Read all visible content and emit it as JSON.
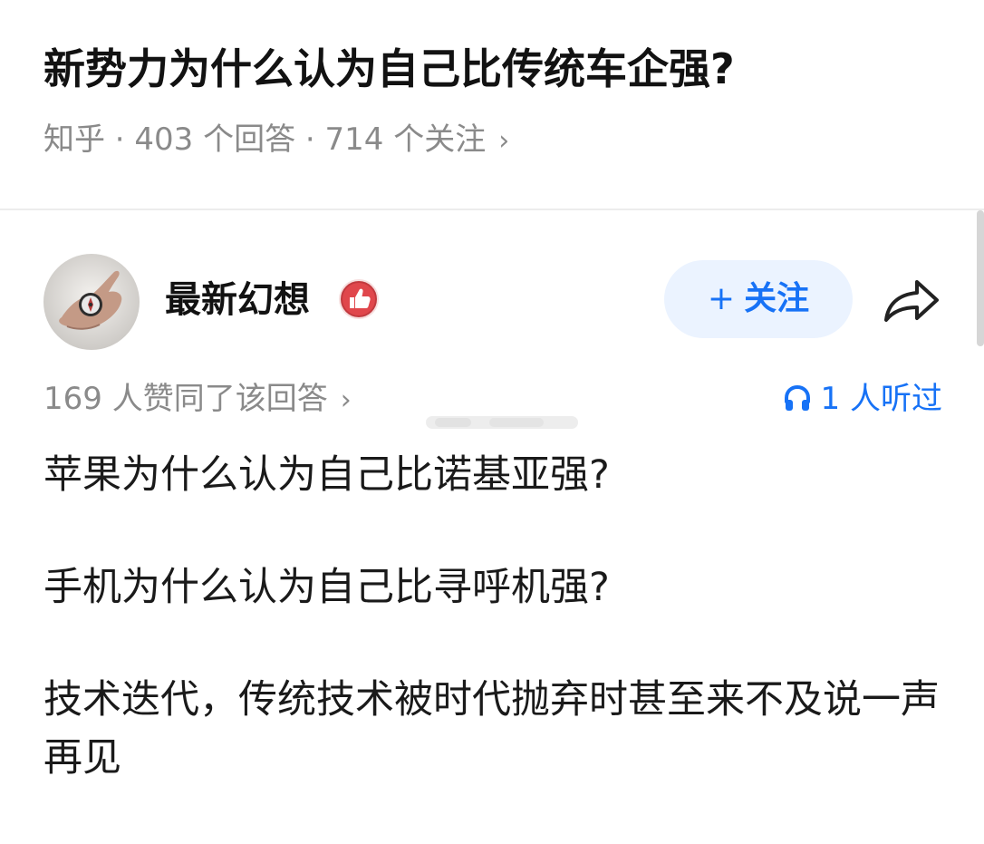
{
  "question": {
    "title": "新势力为什么认为自己比传统车企强?",
    "meta": "知乎 · 403 个回答 · 714 个关注",
    "meta_chevron": "›"
  },
  "author": {
    "name": "最新幻想",
    "avatar_icon": "compass-in-hand-photo",
    "badge_icon": "thumbs-up-badge-icon",
    "follow_plus": "+",
    "follow_label": "关注",
    "share_icon": "share-arrow-icon"
  },
  "answer": {
    "upvote_text": "169 人赞同了该回答",
    "upvote_chevron": "›",
    "listen_icon": "headphones-icon",
    "listen_text": "1 人听过",
    "paragraphs": [
      "苹果为什么认为自己比诺基亚强?",
      "手机为什么认为自己比寻呼机强?",
      "技术迭代，传统技术被时代抛弃时甚至来不及说一声再见"
    ]
  },
  "colors": {
    "accent": "#1772f6",
    "follow_bg": "#ebf3ff",
    "muted_text": "#8a8a8a",
    "badge_red": "#e0474c"
  }
}
